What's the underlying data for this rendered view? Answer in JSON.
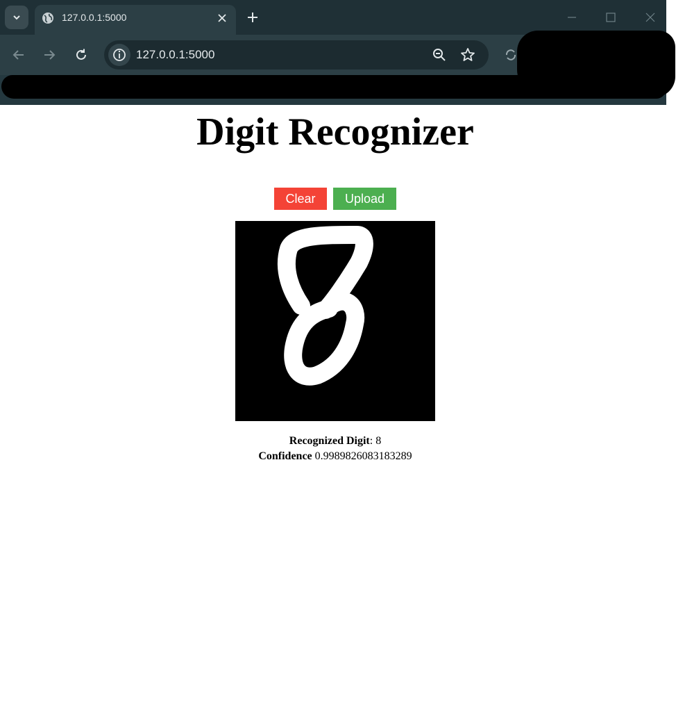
{
  "browser": {
    "tab_title": "127.0.0.1:5000",
    "url": "127.0.0.1:5000"
  },
  "page": {
    "title": "Digit Recognizer",
    "clear_label": "Clear",
    "upload_label": "Upload",
    "result": {
      "digit_label": "Recognized Digit",
      "digit_separator": ":",
      "digit_value": "8",
      "confidence_label": "Confidence",
      "confidence_value": "0.9989826083183289"
    }
  },
  "colors": {
    "clear_button": "#f44336",
    "upload_button": "#4caf50",
    "canvas_background": "#000000",
    "stroke": "#ffffff"
  }
}
